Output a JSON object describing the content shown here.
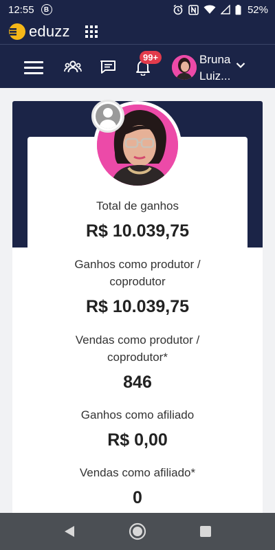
{
  "status_bar": {
    "time": "12:55",
    "b_badge": "B",
    "battery": "52%",
    "icons": [
      "alarm-icon",
      "nfc-icon",
      "wifi-icon",
      "signal-icon",
      "battery-icon"
    ]
  },
  "app": {
    "logo_text": "eduzz",
    "brand_color": "#f5b718",
    "header_color": "#1b2447"
  },
  "nav": {
    "notification_count": "99+",
    "user_first_line": "Bruna",
    "user_second_line": "Luiz...",
    "icons": [
      "menu-icon",
      "people-icon",
      "chat-icon",
      "bell-icon",
      "chevron-down-icon"
    ]
  },
  "stats": {
    "total_label": "Total de ganhos",
    "total_value": "R$ 10.039,75",
    "producer_earnings_label_1": "Ganhos como produtor /",
    "producer_earnings_label_2": "coprodutor",
    "producer_earnings_value": "R$ 10.039,75",
    "producer_sales_label_1": "Vendas como produtor /",
    "producer_sales_label_2": "coprodutor*",
    "producer_sales_value": "846",
    "affiliate_earnings_label": "Ganhos como afiliado",
    "affiliate_earnings_value": "R$ 0,00",
    "affiliate_sales_label": "Vendas como afiliado*",
    "affiliate_sales_value": "0"
  },
  "android_nav": [
    "back-icon",
    "home-icon",
    "recent-apps-icon"
  ]
}
